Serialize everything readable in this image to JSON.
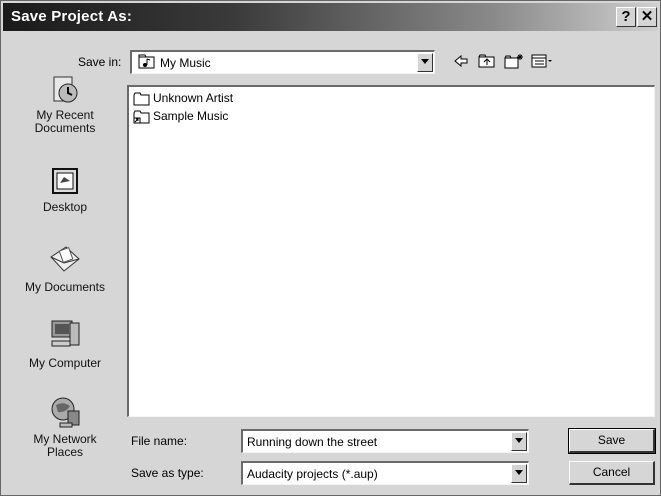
{
  "dialog": {
    "title": "Save Project As:",
    "help_glyph": "?",
    "close_glyph": "✕"
  },
  "save_in": {
    "label": "Save in:",
    "value": "My Music",
    "icon": "music-folder-icon"
  },
  "toolbar": {
    "back_icon": "back-arrow-icon",
    "up_icon": "up-folder-icon",
    "new_folder_icon": "new-folder-icon",
    "view_menu_icon": "view-menu-icon"
  },
  "places": [
    {
      "label_line1": "My Recent",
      "label_line2": "Documents",
      "icon": "recent-documents-icon"
    },
    {
      "label_line1": "Desktop",
      "label_line2": "",
      "icon": "desktop-icon"
    },
    {
      "label_line1": "My Documents",
      "label_line2": "",
      "icon": "my-documents-icon"
    },
    {
      "label_line1": "My Computer",
      "label_line2": "",
      "icon": "my-computer-icon"
    },
    {
      "label_line1": "My Network",
      "label_line2": "Places",
      "icon": "network-places-icon"
    }
  ],
  "files": [
    {
      "name": "Unknown Artist",
      "icon": "folder-icon"
    },
    {
      "name": "Sample Music",
      "icon": "shortcut-folder-icon"
    }
  ],
  "file_name": {
    "label": "File name:",
    "value": "Running down the street"
  },
  "save_as_type": {
    "label": "Save as type:",
    "value": "Audacity projects (*.aup)"
  },
  "buttons": {
    "save": "Save",
    "cancel": "Cancel"
  }
}
